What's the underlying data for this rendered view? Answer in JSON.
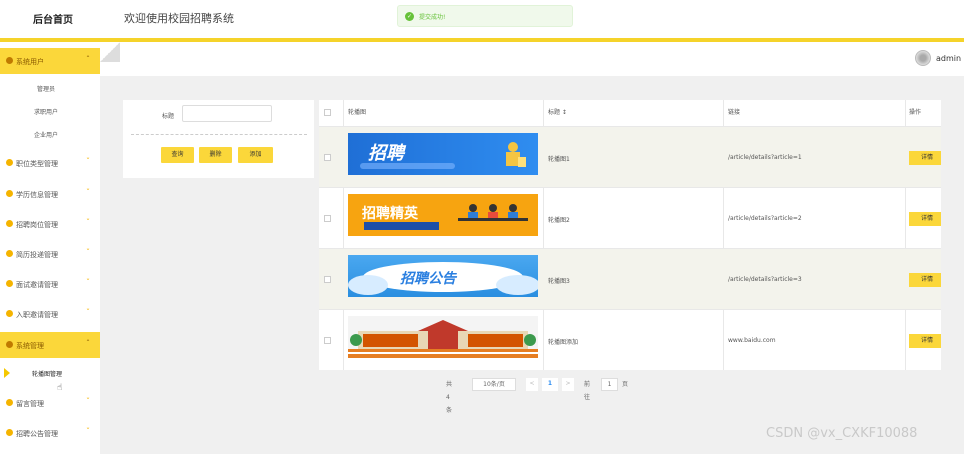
{
  "header": {
    "brand": "后台首页",
    "welcome": "欢迎使用校园招聘系统",
    "toast": "提交成功!"
  },
  "user": {
    "name": "admin"
  },
  "sidebar": {
    "groups": [
      {
        "label": "系统用户",
        "active": true,
        "subitems": [
          "管理员",
          "求职用户",
          "企业用户"
        ]
      },
      {
        "label": "职位类型管理"
      },
      {
        "label": "学历信息管理"
      },
      {
        "label": "招聘岗位管理"
      },
      {
        "label": "简历投递管理"
      },
      {
        "label": "面试邀请管理"
      },
      {
        "label": "入职邀请管理"
      },
      {
        "label": "系统管理",
        "active": true,
        "subitems": [
          "轮播图管理"
        ]
      },
      {
        "label": "留言管理"
      },
      {
        "label": "招聘公告管理"
      }
    ]
  },
  "search": {
    "title_label": "标题",
    "title_value": "",
    "buttons": {
      "query": "查询",
      "delete": "删除",
      "add": "添加"
    }
  },
  "table": {
    "headers": {
      "image": "轮播图",
      "title": "标题 ↕",
      "link": "链接",
      "action": "操作"
    },
    "rows": [
      {
        "banner_text": "招聘",
        "title": "轮播图1",
        "link": "/article/details?article=1",
        "action": "详情"
      },
      {
        "banner_text": "招聘精英",
        "title": "轮播图2",
        "link": "/article/details?article=2",
        "action": "详情"
      },
      {
        "banner_text": "招聘公告",
        "title": "轮播图3",
        "link": "/article/details?article=3",
        "action": "详情"
      },
      {
        "banner_text": "",
        "title": "轮播图添加",
        "link": "www.baidu.com",
        "action": "详情"
      }
    ]
  },
  "pagination": {
    "total": "共 4 条",
    "page_size": "10条/页",
    "prev": "<",
    "current_page": "1",
    "next": ">",
    "goto_label": "前往",
    "goto_value": "1",
    "page_unit": "页"
  },
  "watermark": "CSDN @vx_CXKF10088",
  "colors": {
    "accent": "#fbd73a",
    "success": "#67c23a"
  }
}
